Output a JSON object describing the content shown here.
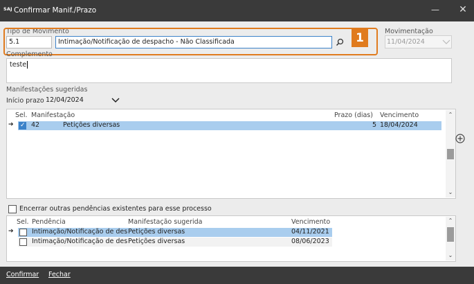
{
  "window": {
    "logo_text": "SAJ",
    "title": "Confirmar Manif./Prazo",
    "minimize_glyph": "—",
    "close_glyph": "✕"
  },
  "form": {
    "tipo_label": "Tipo de Movimento",
    "tipo_code": "5.1",
    "tipo_value": "Intimação/Notificação de despacho - Não Classificada",
    "movimentacao_label": "Movimentação",
    "movimentacao_value": "11/04/2024",
    "complemento_label": "Complemento",
    "complemento_value": "teste",
    "callout": "1"
  },
  "suggested": {
    "section_label": "Manifestações sugeridas",
    "inicio_label": "Início prazo",
    "inicio_value": "12/04/2024",
    "headers": {
      "sel": "Sel.",
      "manifestacao": "Manifestação",
      "prazo": "Prazo (dias)",
      "vencimento": "Vencimento"
    },
    "rows": [
      {
        "code": "42",
        "name": "Petições diversas",
        "prazo": "5",
        "vencimento": "18/04/2024",
        "checked": true
      }
    ]
  },
  "pending": {
    "checkbox_label": "Encerrar outras pendências existentes para esse processo",
    "headers": {
      "sel": "Sel.",
      "pendencia": "Pendência",
      "manifestacao": "Manifestação sugerida",
      "vencimento": "Vencimento"
    },
    "rows": [
      {
        "pendencia": "Intimação/Notificação de desp",
        "manifestacao": "Petições diversas",
        "vencimento": "04/11/2021"
      },
      {
        "pendencia": "Intimação/Notificação de desp",
        "manifestacao": "Petições diversas",
        "vencimento": "08/06/2023"
      }
    ]
  },
  "footer": {
    "confirm_label": "Confirmar",
    "close_label": "Fechar"
  },
  "colors": {
    "accent": "#e07b1e",
    "selection": "#a9cdee",
    "titlebar": "#3a3a3a"
  }
}
